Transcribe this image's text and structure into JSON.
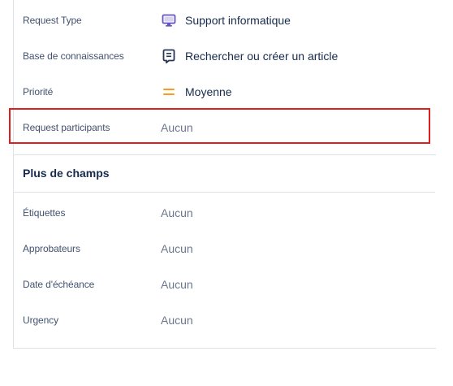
{
  "fields": [
    {
      "label": "Request Type",
      "value": "Support informatique",
      "icon": "monitor-icon"
    },
    {
      "label": "Base de connaissances",
      "value": "Rechercher ou créer un article",
      "icon": "knowledge-base-icon"
    },
    {
      "label": "Priorité",
      "value": "Moyenne",
      "icon": "priority-medium-icon"
    },
    {
      "label": "Request participants",
      "value": "Aucun"
    }
  ],
  "more_fields": {
    "title": "Plus de champs",
    "items": [
      {
        "label": "Étiquettes",
        "value": "Aucun"
      },
      {
        "label": "Approbateurs",
        "value": "Aucun"
      },
      {
        "label": "Date d'échéance",
        "value": "Aucun"
      },
      {
        "label": "Urgency",
        "value": "Aucun"
      }
    ]
  },
  "colors": {
    "highlight": "#e01e1e",
    "monitor": "#6554c0",
    "priority": "#ff991f",
    "text": "#172b4d",
    "muted": "#6b778c"
  }
}
